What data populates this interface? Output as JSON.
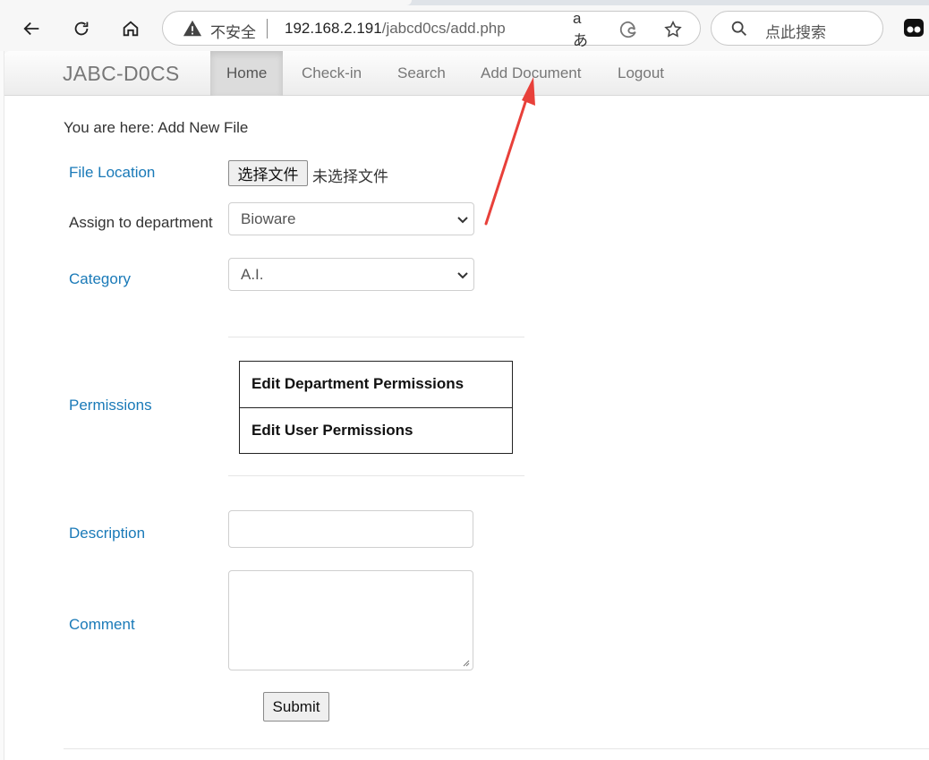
{
  "browser": {
    "not_secure_label": "不安全",
    "url_host": "192.168.2.191",
    "url_path": "/jabcd0cs/add.php",
    "search_placeholder": "点此搜索",
    "read_aloud_glyph": "aあ"
  },
  "navbar": {
    "brand": "JABC-D0CS",
    "items": [
      {
        "label": "Home",
        "active": true
      },
      {
        "label": "Check-in",
        "active": false
      },
      {
        "label": "Search",
        "active": false
      },
      {
        "label": "Add Document",
        "active": false
      },
      {
        "label": "Logout",
        "active": false
      }
    ]
  },
  "breadcrumb": "You are here: Add New File",
  "form": {
    "file_location_label": "File Location",
    "file_button_label": "选择文件",
    "file_status": "未选择文件",
    "department_label": "Assign to department",
    "department_value": "Bioware",
    "category_label": "Category",
    "category_value": "A.I.",
    "permissions_label": "Permissions",
    "permission_rows": [
      "Edit Department Permissions",
      "Edit User Permissions"
    ],
    "description_label": "Description",
    "description_value": "",
    "comment_label": "Comment",
    "comment_value": "",
    "submit_label": "Submit"
  },
  "colors": {
    "label_blue": "#1a7ab8",
    "annotation_red": "#e8403a"
  }
}
